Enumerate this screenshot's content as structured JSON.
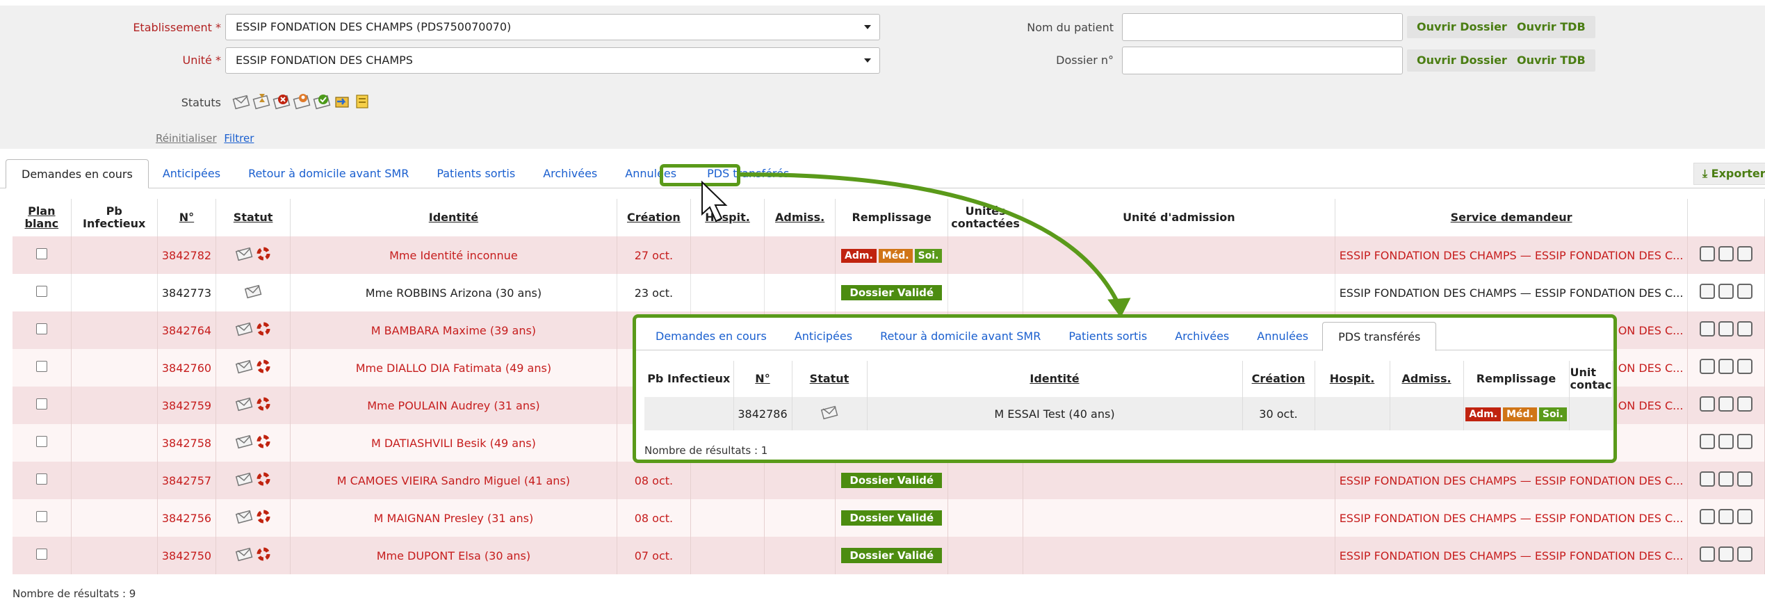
{
  "filters": {
    "etablissement_label": "Etablissement",
    "etablissement_value": "ESSIP FONDATION DES CHAMPS (PDS750070070)",
    "unite_label": "Unité",
    "unite_value": "ESSIP FONDATION DES CHAMPS",
    "required_mark": "*",
    "statuts_label": "Statuts",
    "nom_patient_label": "Nom du patient",
    "dossier_label": "Dossier n°",
    "ouvrir_dossier": "Ouvrir Dossier",
    "ouvrir_tdb": "Ouvrir TDB",
    "reset": "Réinitialiser",
    "filter": "Filtrer"
  },
  "status_icons": [
    "envelope-icon",
    "hourglass-icon",
    "cross-circle-icon",
    "person-icon",
    "check-circle-icon",
    "forward-icon",
    "folder-icon"
  ],
  "tabs": [
    {
      "label": "Demandes en cours",
      "active": true
    },
    {
      "label": "Anticipées",
      "active": false
    },
    {
      "label": "Retour à domicile avant SMR",
      "active": false
    },
    {
      "label": "Patients sortis",
      "active": false
    },
    {
      "label": "Archivées",
      "active": false
    },
    {
      "label": "Annulées",
      "active": false
    },
    {
      "label": "PDS transférés",
      "active": false
    }
  ],
  "export_label": "Exporter",
  "table": {
    "headers": [
      "Plan blanc",
      "Pb Infectieux",
      "N°",
      "Statut",
      "Identité",
      "Création",
      "Hospit.",
      "Admiss.",
      "Remplissage",
      "Unités contactées",
      "Unité d'admission",
      "Service demandeur",
      ""
    ],
    "rows": [
      {
        "num": "3842782",
        "identite": "Mme Identité inconnue",
        "creation": "27 oct.",
        "remplissage": "badges",
        "service": "ESSIP FONDATION DES CHAMPS — ESSIP FONDATION DES C...",
        "style": "pink",
        "red": true
      },
      {
        "num": "3842773",
        "identite": "Mme ROBBINS Arizona (30 ans)",
        "creation": "23 oct.",
        "remplissage": "valid",
        "service": "ESSIP FONDATION DES CHAMPS — ESSIP FONDATION DES C...",
        "style": "plain",
        "red": false
      },
      {
        "num": "3842764",
        "identite": "M BAMBARA Maxime (39 ans)",
        "creation": "",
        "remplissage": "",
        "service": "ON DES C...",
        "style": "pink",
        "red": true
      },
      {
        "num": "3842760",
        "identite": "Mme DIALLO DIA Fatimata (49 ans)",
        "creation": "",
        "remplissage": "",
        "service": "ON DES C...",
        "style": "white",
        "red": true
      },
      {
        "num": "3842759",
        "identite": "Mme POULAIN Audrey (31 ans)",
        "creation": "",
        "remplissage": "",
        "service": "ON DES C...",
        "style": "pink",
        "red": true
      },
      {
        "num": "3842758",
        "identite": "M DATIASHVILI Besik (49 ans)",
        "creation": "",
        "remplissage": "",
        "service": "",
        "style": "white",
        "red": true
      },
      {
        "num": "3842757",
        "identite": "M CAMOES VIEIRA Sandro Miguel (41 ans)",
        "creation": "08 oct.",
        "remplissage": "valid",
        "service": "ESSIP FONDATION DES CHAMPS — ESSIP FONDATION DES C...",
        "style": "pink",
        "red": true
      },
      {
        "num": "3842756",
        "identite": "M MAIGNAN Presley (31 ans)",
        "creation": "08 oct.",
        "remplissage": "valid",
        "service": "ESSIP FONDATION DES CHAMPS — ESSIP FONDATION DES C...",
        "style": "white",
        "red": true
      },
      {
        "num": "3842750",
        "identite": "Mme DUPONT Elsa (30 ans)",
        "creation": "07 oct.",
        "remplissage": "valid",
        "service": "ESSIP FONDATION DES CHAMPS — ESSIP FONDATION DES C...",
        "style": "pink",
        "red": true
      }
    ]
  },
  "badges": {
    "adm": "Adm.",
    "med": "Méd.",
    "soi": "Soi."
  },
  "valid_label": "Dossier Validé",
  "results_label": "Nombre de résultats : 9",
  "overlay": {
    "tabs": [
      {
        "label": "Demandes en cours",
        "active": false
      },
      {
        "label": "Anticipées",
        "active": false
      },
      {
        "label": "Retour à domicile avant SMR",
        "active": false
      },
      {
        "label": "Patients sortis",
        "active": false
      },
      {
        "label": "Archivées",
        "active": false
      },
      {
        "label": "Annulées",
        "active": false
      },
      {
        "label": "PDS transférés",
        "active": true
      }
    ],
    "headers": [
      "Pb Infectieux",
      "N°",
      "Statut",
      "Identité",
      "Création",
      "Hospit.",
      "Admiss.",
      "Remplissage",
      "Unit contac"
    ],
    "row": {
      "num": "3842786",
      "identite": "M ESSAI Test (40 ans)",
      "creation": "30 oct."
    },
    "results_label": "Nombre de résultats : 1"
  },
  "colors": {
    "accent_green": "#5a9a1a",
    "link_blue": "#1a5fcf",
    "row_red": "#c61d1d",
    "badge_red": "#c0230f"
  }
}
